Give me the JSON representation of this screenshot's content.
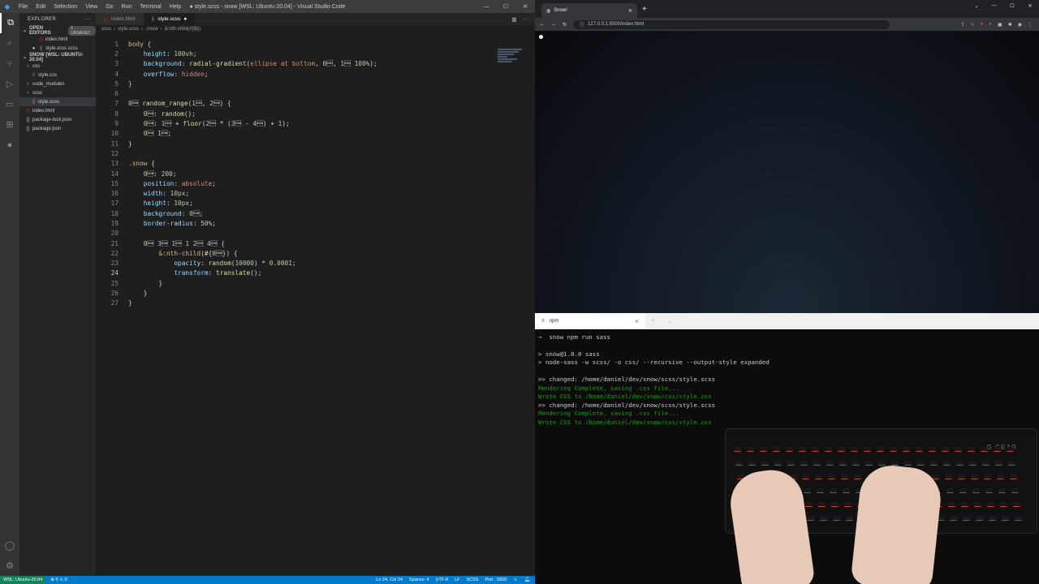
{
  "vscode": {
    "window_title": "● style.scss - snow [WSL: Ubuntu-20.04] - Visual Studio Code",
    "menu": [
      "File",
      "Edit",
      "Selection",
      "View",
      "Go",
      "Run",
      "Terminal",
      "Help"
    ],
    "sidebar": {
      "header": "EXPLORER",
      "open_editors_label": "OPEN EDITORS",
      "unsaved_badge": "1 UNSAVED",
      "open_editors": [
        {
          "label": "index.html",
          "icon": "html-file-icon"
        },
        {
          "label": "style.scss scss",
          "icon": "scss-file-icon"
        }
      ],
      "workspace_label": "SNOW [WSL: UBUNTU-20.04]",
      "tree": [
        {
          "label": "css",
          "type": "folder",
          "depth": 1
        },
        {
          "label": "style.css",
          "type": "file",
          "depth": 2
        },
        {
          "label": "node_modules",
          "type": "folder",
          "depth": 1
        },
        {
          "label": "scss",
          "type": "folder",
          "depth": 1
        },
        {
          "label": "style.scss",
          "type": "file",
          "depth": 2,
          "selected": true
        },
        {
          "label": "index.html",
          "type": "file",
          "depth": 1
        },
        {
          "label": "package-lock.json",
          "type": "file",
          "depth": 1
        },
        {
          "label": "package.json",
          "type": "file",
          "depth": 1
        }
      ]
    },
    "tabs": [
      {
        "label": "index.html",
        "active": false
      },
      {
        "label": "style.scss",
        "active": true,
        "dirty": true
      }
    ],
    "breadcrumb": [
      "scss",
      "style.scss",
      ".snow",
      "&:nth-child(#{$i})"
    ],
    "current_line": 24,
    "code_lines": [
      "body {",
      "    height: 100vh;",
      "    background: radial-gradient(ellipse at bottom, #1b2735, #090a0f 100%);",
      "    overflow: hidden;",
      "}",
      "",
      "@function random_range($min, $max) {",
      "    $rand: random();",
      "    $random_range: $min + floor($rand * ($max - $min) + 1);",
      "    @return $random_range;",
      "}",
      "",
      ".snow {",
      "    $total: 200;",
      "    position: absolute;",
      "    width: 10px;",
      "    height: 10px;",
      "    background: white;",
      "    border-radius: 50%;",
      "",
      "    @for $i from 1 through $total {",
      "        &:nth-child(#{$i}) {",
      "            opacity: random(10000) * 0.0001;",
      "            transform: translate();",
      "        }",
      "    }",
      "}"
    ],
    "colors": {
      "swatch1": "#1b2735",
      "swatch2": "#090a0f",
      "swatch3": "#ffffff",
      "accent": "#007acc"
    },
    "statusbar": {
      "remote": "WSL: Ubuntu-20.04",
      "problems": "⊗ 0 ⚠ 0",
      "position": "Ln 24, Col 24",
      "spaces": "Spaces: 4",
      "encoding": "UTF-8",
      "eol": "LF",
      "language": "SCSS",
      "port": "Port : 5500"
    }
  },
  "browser": {
    "tab_title": "Snow!",
    "url": "127.0.0.1:5500/index.html"
  },
  "terminal": {
    "tab_title": "npm",
    "lines": [
      {
        "text": "→  snow npm run sass",
        "style": "prompt"
      },
      {
        "text": "",
        "style": "plain"
      },
      {
        "text": "> snow@1.0.0 sass",
        "style": "plain"
      },
      {
        "text": "> node-sass -w scss/ -o css/ --recursive --output-style expanded",
        "style": "plain"
      },
      {
        "text": "",
        "style": "plain"
      },
      {
        "text": "=> changed: /home/daniel/dev/snow/scss/style.scss",
        "style": "plain"
      },
      {
        "text": "Rendering Complete, saving .css file...",
        "style": "g"
      },
      {
        "text": "Wrote CSS to /home/daniel/dev/snow/css/style.css",
        "style": "g"
      },
      {
        "text": "=> changed: /home/daniel/dev/snow/scss/style.scss",
        "style": "plain"
      },
      {
        "text": "Rendering Complete, saving .css file...",
        "style": "g"
      },
      {
        "text": "Wrote CSS to /home/daniel/dev/snow/css/style.css",
        "style": "g"
      }
    ]
  },
  "keyboard_brand": "G GEAR"
}
